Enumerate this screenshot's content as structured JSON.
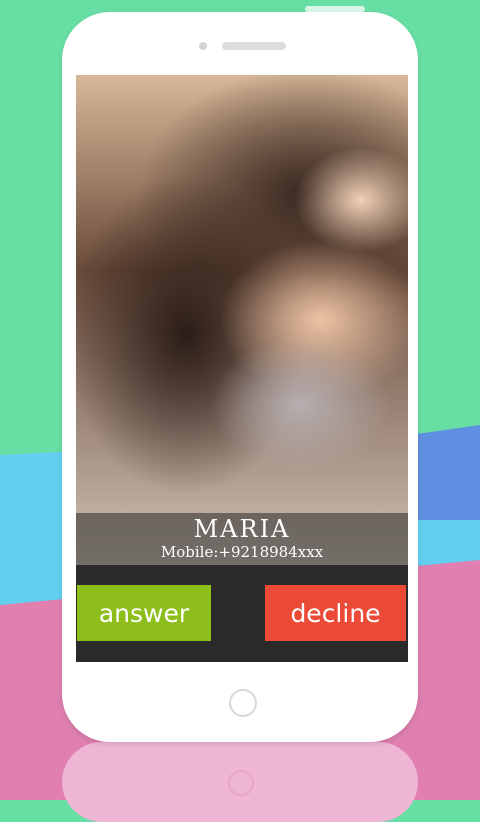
{
  "caller": {
    "name": "MARIA",
    "number": "Mobile:+9218984xxx"
  },
  "actions": {
    "answer_label": "answer",
    "decline_label": "decline"
  },
  "colors": {
    "answer": "#8dbe1b",
    "decline": "#eb4a37",
    "background_green": "#67dfa4",
    "background_pink": "#e07fb0",
    "background_blue": "#63cff0"
  },
  "icons": [
    "home-button-icon",
    "speaker-icon",
    "front-camera-icon"
  ]
}
